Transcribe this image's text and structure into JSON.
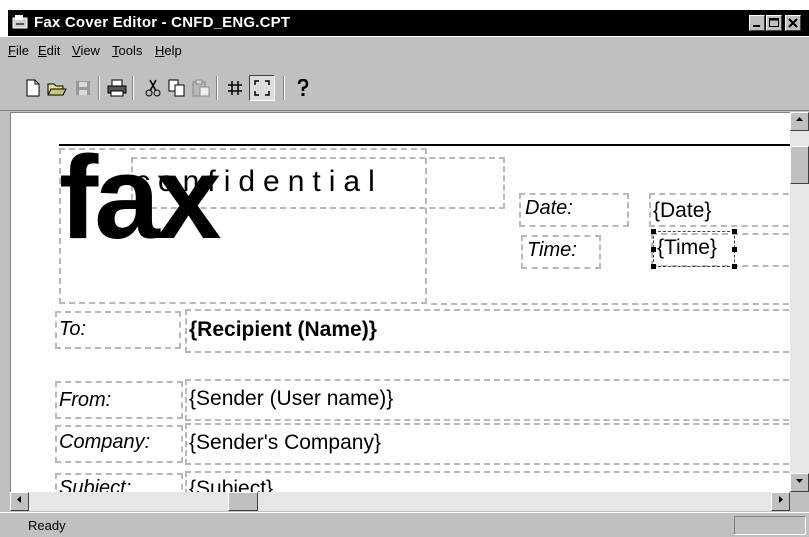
{
  "window": {
    "title": "Fax Cover Editor - CNFD_ENG.CPT"
  },
  "menu": [
    "File",
    "Edit",
    "View",
    "Tools",
    "Help"
  ],
  "toolbar": {
    "icons": [
      "new-icon",
      "open-icon",
      "save-icon",
      "print-icon",
      "cut-icon",
      "copy-icon",
      "paste-icon",
      "grid-icon",
      "select-icon",
      "help-icon"
    ]
  },
  "document": {
    "fax_text": "fax",
    "confidential_text": "confidential",
    "fields": {
      "date_label": "Date:",
      "date_value": "{Date}",
      "time_label": "Time:",
      "time_value": "{Time}",
      "to_label": "To:",
      "to_value": "{Recipient (Name)}",
      "from_label": "From:",
      "from_value": "{Sender (User name)}",
      "company_label": "Company:",
      "company_value": "{Sender's Company}",
      "subject_label": "Subject:",
      "subject_value": "{Subject}"
    }
  },
  "status": {
    "text": "Ready"
  },
  "colors": {
    "titlebar": "#000000",
    "chrome": "#c0c0c0",
    "canvas": "#ffffff",
    "dashed_border": "#b8b8b8"
  }
}
